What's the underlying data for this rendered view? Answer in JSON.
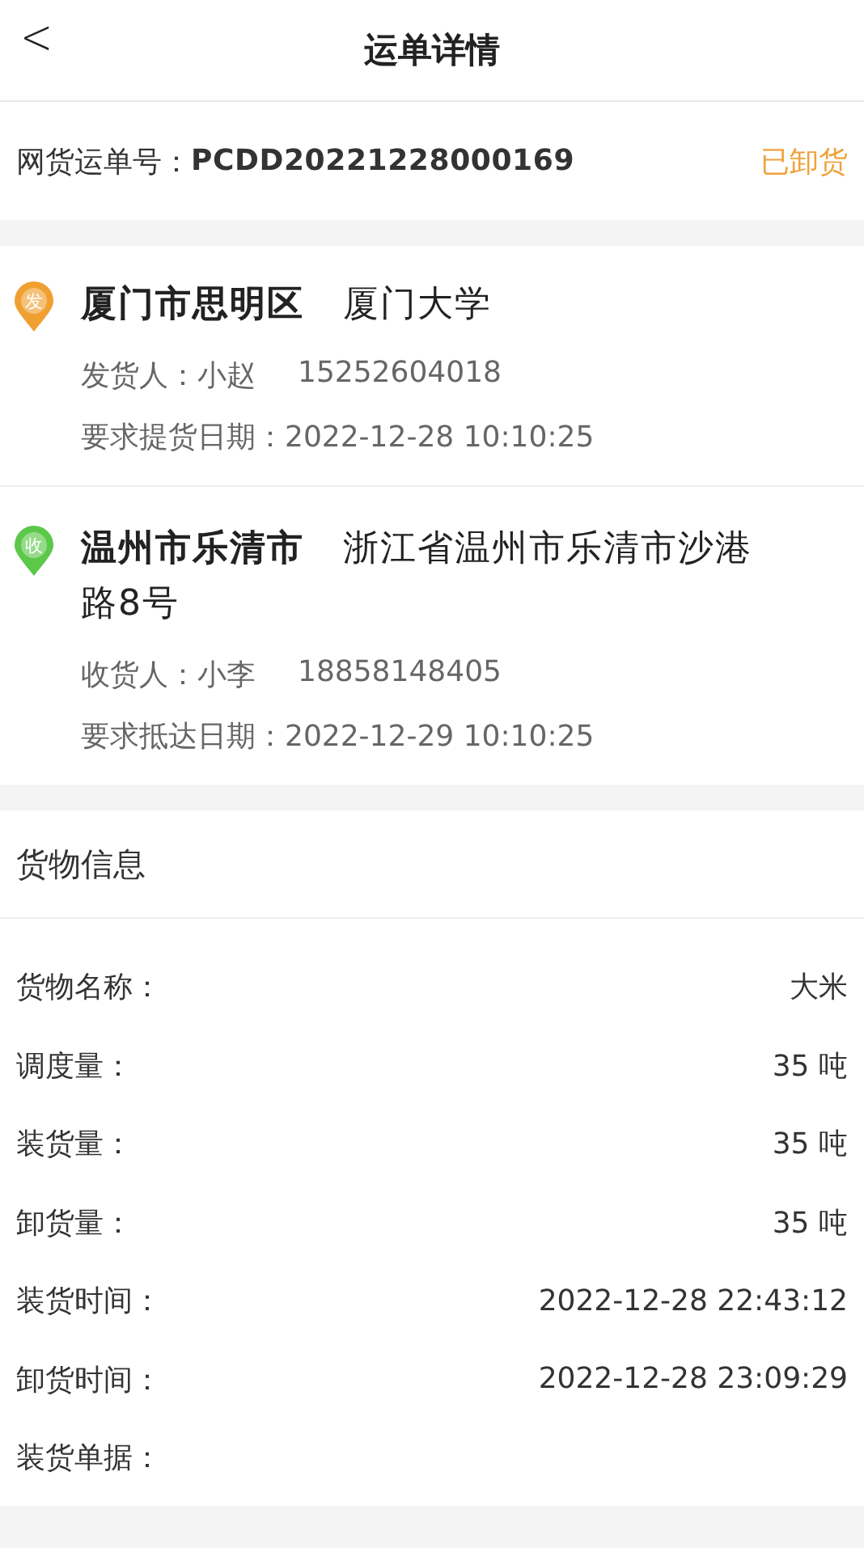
{
  "nav": {
    "back": "<",
    "title": "运单详情"
  },
  "order": {
    "label": "网货运单号：",
    "number": "PCDD20221228000169",
    "status": "已卸货"
  },
  "stops": [
    {
      "badge": "发",
      "color": "#f0a030",
      "city": "厦门市思明区",
      "address": "厦门大学",
      "contact": "发货人：小赵",
      "phone": "15252604018",
      "date": "要求提货日期：2022-12-28 10:10:25"
    },
    {
      "badge": "收",
      "color": "#5cc84a",
      "city": "温州市乐清市",
      "address": "浙江省温州市乐清市沙港路8号",
      "contact": "收货人：小李",
      "phone": "18858148405",
      "date": "要求抵达日期：2022-12-29 10:10:25"
    }
  ],
  "goods": {
    "title": "货物信息",
    "rows": [
      {
        "label": "货物名称：",
        "value": "大米"
      },
      {
        "label": "调度量：",
        "value": "35 吨"
      },
      {
        "label": "装货量：",
        "value": "35 吨"
      },
      {
        "label": "卸货量：",
        "value": "35 吨"
      },
      {
        "label": "装货时间：",
        "value": "2022-12-28 22:43:12"
      },
      {
        "label": "卸货时间：",
        "value": "2022-12-28 23:09:29"
      },
      {
        "label": "装货单据：",
        "value": ""
      }
    ]
  }
}
